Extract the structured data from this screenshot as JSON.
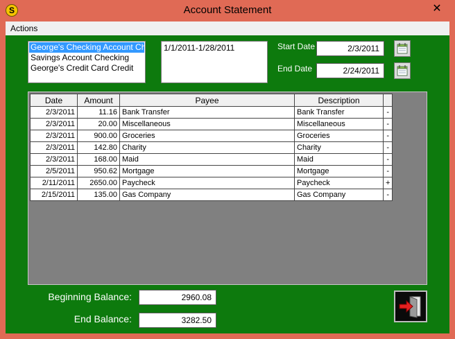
{
  "window": {
    "title": "Account Statement",
    "app_icon_glyph": "S",
    "close_glyph": "✕"
  },
  "menu": {
    "actions": "Actions"
  },
  "accounts": {
    "items": [
      "George's Checking Account Checking",
      "Savings Account Checking",
      "George's Credit Card Credit"
    ],
    "selected_index": 0
  },
  "ranges": {
    "items": [
      "1/1/2011-1/28/2011"
    ]
  },
  "dates": {
    "start_label": "Start Date",
    "start_value": "2/3/2011",
    "end_label": "End Date",
    "end_value": "2/24/2011"
  },
  "table": {
    "headers": {
      "date": "Date",
      "amount": "Amount",
      "payee": "Payee",
      "description": "Description",
      "sign": ""
    },
    "rows": [
      {
        "date": "2/3/2011",
        "amount": "11.16",
        "payee": "Bank Transfer",
        "description": "Bank Transfer",
        "sign": "-"
      },
      {
        "date": "2/3/2011",
        "amount": "20.00",
        "payee": "Miscellaneous",
        "description": "Miscellaneous",
        "sign": "-"
      },
      {
        "date": "2/3/2011",
        "amount": "900.00",
        "payee": "Groceries",
        "description": "Groceries",
        "sign": "-"
      },
      {
        "date": "2/3/2011",
        "amount": "142.80",
        "payee": "Charity",
        "description": "Charity",
        "sign": "-"
      },
      {
        "date": "2/3/2011",
        "amount": "168.00",
        "payee": "Maid",
        "description": "Maid",
        "sign": "-"
      },
      {
        "date": "2/5/2011",
        "amount": "950.62",
        "payee": "Mortgage",
        "description": "Mortgage",
        "sign": "-"
      },
      {
        "date": "2/11/2011",
        "amount": "2650.00",
        "payee": "Paycheck",
        "description": "Paycheck",
        "sign": "+"
      },
      {
        "date": "2/15/2011",
        "amount": "135.00",
        "payee": "Gas Company",
        "description": "Gas Company",
        "sign": "-"
      }
    ]
  },
  "balances": {
    "beginning_label": "Beginning Balance:",
    "beginning_value": "2960.08",
    "end_label": "End Balance:",
    "end_value": "3282.50"
  },
  "icons": {
    "calendar": "calendar-icon",
    "exit": "exit-door-icon"
  },
  "colors": {
    "title_bar": "#e06a55",
    "client_bg": "#0d7a0d",
    "selection": "#3399ff",
    "grid_bg": "#808080"
  }
}
